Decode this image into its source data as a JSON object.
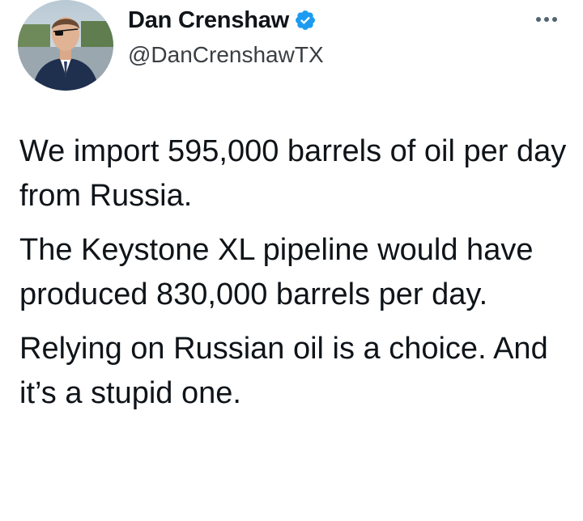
{
  "author": {
    "display_name": "Dan Crenshaw",
    "handle": "@DanCrenshawTX",
    "verified": true,
    "avatar_icon": "profile-photo",
    "verified_icon": "verified-badge-icon",
    "verified_color": "#1d9bf0"
  },
  "menu": {
    "icon": "more-horizontal-icon"
  },
  "tweet": {
    "paragraphs": [
      "We import 595,000 barrels of oil per day from Russia.",
      "The Keystone XL pipeline would have produced 830,000 barrels per day.",
      "Relying on Russian oil is a choice. And it’s a stupid one."
    ]
  }
}
